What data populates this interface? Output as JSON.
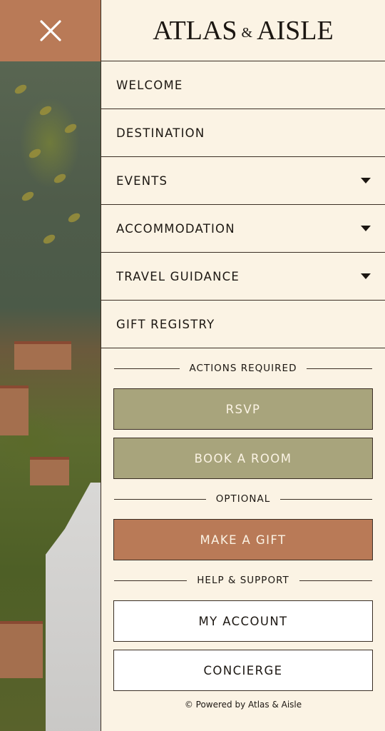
{
  "close_icon": "close-icon",
  "brand": {
    "left": "ATLAS",
    "amp": "&",
    "right": "AISLE"
  },
  "nav": [
    {
      "label": "WELCOME",
      "caret": false
    },
    {
      "label": "DESTINATION",
      "caret": false
    },
    {
      "label": "EVENTS",
      "caret": true
    },
    {
      "label": "ACCOMMODATION",
      "caret": true
    },
    {
      "label": "TRAVEL GUIDANCE",
      "caret": true
    },
    {
      "label": "GIFT REGISTRY",
      "caret": false
    }
  ],
  "sections": {
    "actions_required": "ACTIONS REQUIRED",
    "optional": "OPTIONAL",
    "help_support": "HELP & SUPPORT"
  },
  "buttons": {
    "rsvp": "RSVP",
    "book_room": "BOOK A ROOM",
    "make_gift": "MAKE A GIFT",
    "my_account": "MY ACCOUNT",
    "concierge": "CONCIERGE"
  },
  "footer": "© Powered by Atlas & Aisle",
  "colors": {
    "panel_bg": "#fbf3e4",
    "accent_terracotta": "#b97a57",
    "olive": "#a8a47c",
    "ink": "#1c1712"
  }
}
